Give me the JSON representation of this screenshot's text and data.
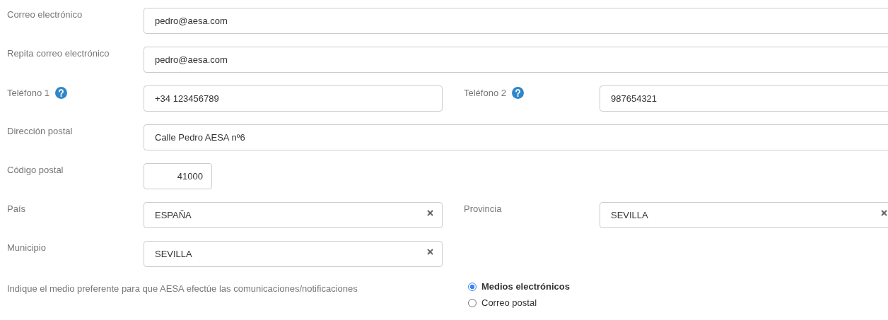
{
  "rows": [
    {
      "kind": "single",
      "fields": [
        {
          "label": "Correo electrónico",
          "value": "pedro@aesa.com",
          "help": false,
          "clearable": false
        }
      ]
    },
    {
      "kind": "single",
      "fields": [
        {
          "label": "Repita correo electrónico",
          "value": "pedro@aesa.com",
          "help": false,
          "clearable": false
        }
      ]
    },
    {
      "kind": "pair",
      "fields": [
        {
          "label": "Teléfono 1",
          "value": "+34 123456789",
          "help": true,
          "clearable": false
        },
        {
          "label": "Teléfono 2",
          "value": "987654321",
          "help": true,
          "clearable": false
        }
      ]
    },
    {
      "kind": "single",
      "fields": [
        {
          "label": "Dirección postal",
          "value": "Calle Pedro AESA nº6",
          "help": false,
          "clearable": false
        }
      ]
    },
    {
      "kind": "short",
      "fields": [
        {
          "label": "Código postal",
          "value": "41000",
          "help": false,
          "clearable": false
        }
      ]
    },
    {
      "kind": "pair",
      "fields": [
        {
          "label": "País",
          "value": "ESPAÑA",
          "help": false,
          "clearable": true
        },
        {
          "label": "Provincia",
          "value": "SEVILLA",
          "help": false,
          "clearable": true
        }
      ]
    },
    {
      "kind": "pair",
      "fields": [
        {
          "label": "Municipio",
          "value": "SEVILLA",
          "help": false,
          "clearable": true
        }
      ]
    }
  ],
  "preference": {
    "question": "Indique el medio preferente para que AESA efectúe las comunicaciones/notificaciones",
    "options": [
      {
        "label": "Medios electrónicos",
        "selected": true
      },
      {
        "label": "Correo postal",
        "selected": false
      }
    ]
  }
}
